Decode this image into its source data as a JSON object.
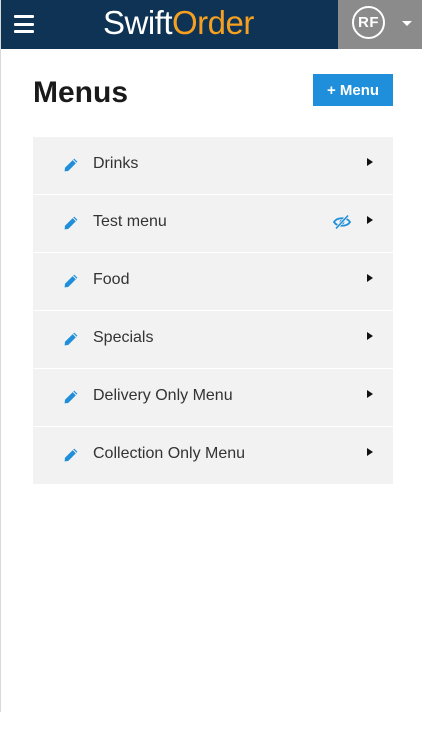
{
  "header": {
    "menu_icon": "hamburger-icon",
    "brand_part1": "Swift",
    "brand_part2": "Order",
    "brand_color_primary": "#ffffff",
    "brand_color_accent": "#f5a020",
    "user_initials": "RF",
    "dropdown_icon": "caret-down-icon"
  },
  "page": {
    "title": "Menus",
    "add_button_label": "+ Menu"
  },
  "menus": [
    {
      "label": "Drinks",
      "hidden": false
    },
    {
      "label": "Test menu",
      "hidden": true
    },
    {
      "label": "Food",
      "hidden": false
    },
    {
      "label": "Specials",
      "hidden": false
    },
    {
      "label": "Delivery Only Menu",
      "hidden": false
    },
    {
      "label": "Collection Only Menu",
      "hidden": false
    }
  ],
  "colors": {
    "topbar": "#0e3354",
    "accent_blue": "#1f8fdb",
    "row_background": "#f2f2f2"
  }
}
